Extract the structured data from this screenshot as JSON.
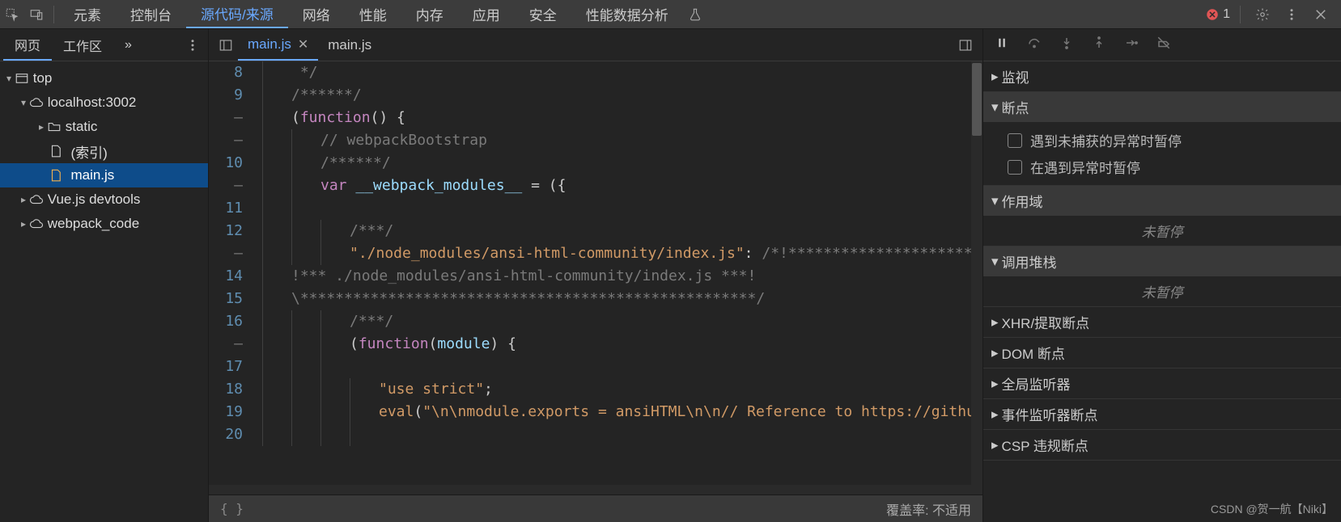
{
  "topbar": {
    "tabs": [
      "元素",
      "控制台",
      "源代码/来源",
      "网络",
      "性能",
      "内存",
      "应用",
      "安全",
      "性能数据分析"
    ],
    "active": 2,
    "error_count": "1"
  },
  "leftPanel": {
    "tabs": [
      "网页",
      "工作区"
    ],
    "active": 0,
    "tree": {
      "top": "top",
      "host": "localhost:3002",
      "static": "static",
      "index": "(索引)",
      "mainjs": "main.js",
      "vue": "Vue.js devtools",
      "webpack": "webpack_code"
    }
  },
  "fileTabs": {
    "items": [
      "main.js",
      "main.js"
    ],
    "active": 0
  },
  "code": {
    "gutter": [
      "8",
      "9",
      "–",
      "–",
      "10",
      "–",
      "11",
      "12",
      "–",
      "14",
      "15",
      "16",
      "–",
      "17",
      "18",
      "19",
      "20"
    ],
    "lines": [
      {
        "indent": 1,
        "tokens": [
          {
            "t": " */",
            "c": "comment"
          }
        ]
      },
      {
        "indent": 1,
        "tokens": [
          {
            "t": "/******/",
            "c": "comment"
          }
        ]
      },
      {
        "indent": 1,
        "tokens": [
          {
            "t": "(",
            "c": ""
          },
          {
            "t": "function",
            "c": "kw"
          },
          {
            "t": "() {",
            "c": ""
          }
        ]
      },
      {
        "indent": 2,
        "tokens": [
          {
            "t": "// webpackBootstrap",
            "c": "comment"
          }
        ]
      },
      {
        "indent": 2,
        "tokens": [
          {
            "t": "/******/",
            "c": "comment"
          }
        ]
      },
      {
        "indent": 2,
        "tokens": [
          {
            "t": "var ",
            "c": "kw"
          },
          {
            "t": "__webpack_modules__",
            "c": "var"
          },
          {
            "t": " = ({",
            "c": ""
          }
        ]
      },
      {
        "indent": 2,
        "tokens": []
      },
      {
        "indent": 3,
        "tokens": [
          {
            "t": "/***/",
            "c": "comment"
          }
        ]
      },
      {
        "indent": 3,
        "tokens": [
          {
            "t": "\"./node_modules/ansi-html-community/index.js\"",
            "c": "str"
          },
          {
            "t": ": ",
            "c": ""
          },
          {
            "t": "/*!****************************",
            "c": "comment"
          }
        ]
      },
      {
        "indent": 1,
        "tokens": [
          {
            "t": "!*** ./node_modules/ansi-html-community/index.js ***!",
            "c": "comment"
          }
        ]
      },
      {
        "indent": 1,
        "tokens": [
          {
            "t": "\\****************************************************/",
            "c": "comment"
          }
        ]
      },
      {
        "indent": 3,
        "tokens": [
          {
            "t": "/***/",
            "c": "comment"
          }
        ]
      },
      {
        "indent": 3,
        "tokens": [
          {
            "t": "(",
            "c": ""
          },
          {
            "t": "function",
            "c": "kw"
          },
          {
            "t": "(",
            "c": ""
          },
          {
            "t": "module",
            "c": "obj"
          },
          {
            "t": ") {",
            "c": ""
          }
        ]
      },
      {
        "indent": 3,
        "tokens": []
      },
      {
        "indent": 4,
        "tokens": [
          {
            "t": "\"use strict\"",
            "c": "str"
          },
          {
            "t": ";",
            "c": ""
          }
        ]
      },
      {
        "indent": 4,
        "tokens": [
          {
            "t": "eval",
            "c": "fn"
          },
          {
            "t": "(",
            "c": ""
          },
          {
            "t": "\"\\n\\nmodule.exports = ansiHTML\\n\\n// Reference to https://github.com",
            "c": "str"
          }
        ]
      },
      {
        "indent": 4,
        "tokens": []
      }
    ]
  },
  "coverage": {
    "label": "覆盖率:",
    "value": "不适用"
  },
  "debug": {
    "sections": {
      "watch": "监视",
      "breakpoints": "断点",
      "bp1": "遇到未捕获的异常时暂停",
      "bp2": "在遇到异常时暂停",
      "scope": "作用域",
      "notpaused": "未暂停",
      "callstack": "调用堆栈",
      "xhr": "XHR/提取断点",
      "dom": "DOM 断点",
      "global": "全局监听器",
      "event": "事件监听器断点",
      "csp": "CSP 违规断点"
    }
  },
  "watermark": "CSDN @贺一航【Niki】"
}
